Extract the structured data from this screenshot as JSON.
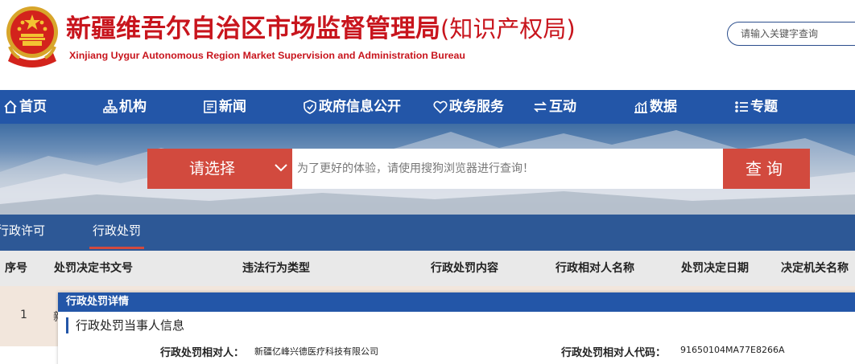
{
  "header": {
    "title_cn_main": "新疆维吾尔自治区市场监督管理局",
    "title_cn_paren": "(知识产权局)",
    "title_en": "Xinjiang Uygur Autonomous Region Market Supervision and Administration Bureau",
    "search_placeholder": "请输入关键字查询",
    "emblem_icon": "national-emblem"
  },
  "nav": {
    "items": [
      {
        "label": "首页",
        "icon": "home-icon"
      },
      {
        "label": "机构",
        "icon": "org-icon"
      },
      {
        "label": "新闻",
        "icon": "news-icon"
      },
      {
        "label": "政府信息公开",
        "icon": "shield-icon"
      },
      {
        "label": "政务服务",
        "icon": "heart-icon"
      },
      {
        "label": "互动",
        "icon": "exchange-icon"
      },
      {
        "label": "数据",
        "icon": "chart-icon"
      },
      {
        "label": "专题",
        "icon": "list-icon"
      }
    ]
  },
  "search": {
    "select_label": "请选择",
    "input_placeholder": "为了更好的体验，请使用搜狗浏览器进行查询！",
    "button_label": "查询"
  },
  "tabs": {
    "items": [
      "行政许可",
      "行政处罚"
    ],
    "active": "行政处罚"
  },
  "table": {
    "headers": [
      "序号",
      "处罚决定书文号",
      "违法行为类型",
      "行政处罚内容",
      "行政相对人名称",
      "处罚决定日期",
      "决定机关名称"
    ],
    "rows": [
      {
        "index": "1",
        "doc_no_partial": "新"
      }
    ]
  },
  "modal": {
    "title": "行政处罚详情",
    "section_title": "行政处罚当事人信息",
    "fields": [
      {
        "label": "行政处罚相对人：",
        "value": "新疆亿峰兴德医疗科技有限公司"
      },
      {
        "label": "行政处罚相对人代码：",
        "value": "91650104MA77E8266A"
      }
    ]
  },
  "colors": {
    "brand_red": "#c8151d",
    "nav_blue": "#2356a8",
    "button_red": "#d24a3e",
    "tab_blue": "#2d5896"
  }
}
